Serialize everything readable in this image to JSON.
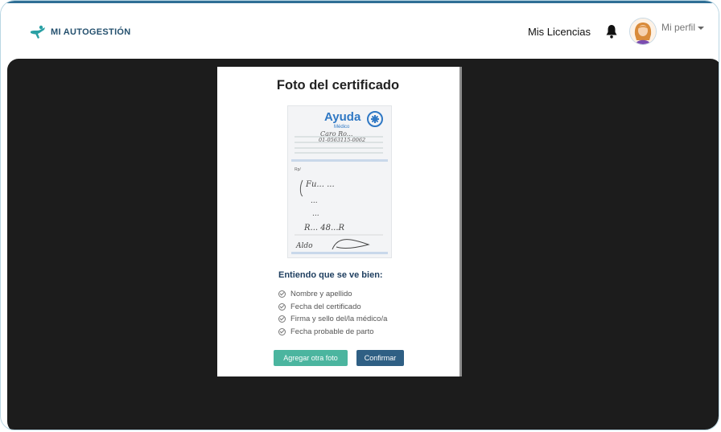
{
  "header": {
    "brand": "MI AUTOGESTIÓN",
    "licencias_link": "Mis Licencias",
    "profile_label": "Mi perfil",
    "icons": [
      "brand-logo-icon",
      "bell-icon",
      "avatar",
      "chevron-down-icon"
    ]
  },
  "modal": {
    "title": "Foto del certificado",
    "certificate": {
      "brand": "Ayuda",
      "brand_sub": "Médico",
      "name_line": "Caro Ro...",
      "id_line": "01-0563115-0062",
      "handwriting": [
        "Fu... ...",
        "...",
        "...",
        "R... 48...R"
      ],
      "signature": "Aldo"
    },
    "checklist_title": "Entiendo que se ve bien:",
    "checklist": [
      "Nombre y apellido",
      "Fecha del certificado",
      "Firma y sello del/la médico/a",
      "Fecha probable de parto"
    ],
    "buttons": {
      "add_photo": "Agregar otra foto",
      "confirm": "Confirmar"
    }
  },
  "colors": {
    "overlay": "#1c1c1c",
    "primary": "#2f5f84",
    "secondary": "#4bb59f",
    "brand_text": "#24506e"
  }
}
